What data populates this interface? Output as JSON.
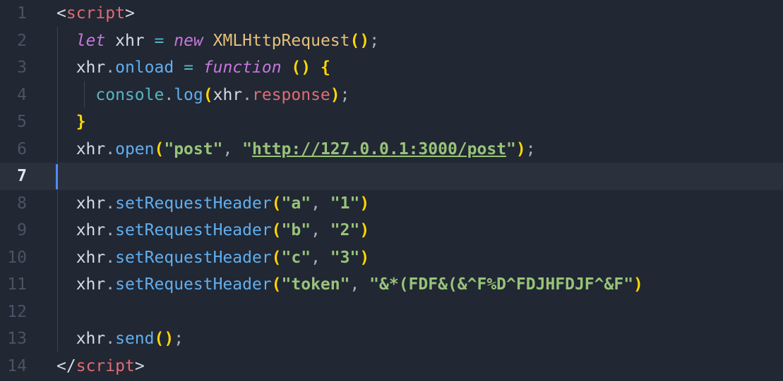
{
  "editor": {
    "lines": [
      {
        "num": "1",
        "tokens": [
          {
            "t": "<",
            "c": "angle"
          },
          {
            "t": "script",
            "c": "tag"
          },
          {
            "t": ">",
            "c": "angle"
          }
        ]
      },
      {
        "num": "2",
        "tokens": [
          {
            "t": "  "
          },
          {
            "t": "let",
            "c": "kw"
          },
          {
            "t": " xhr ",
            "c": "var"
          },
          {
            "t": "=",
            "c": "op"
          },
          {
            "t": " "
          },
          {
            "t": "new",
            "c": "kw"
          },
          {
            "t": " "
          },
          {
            "t": "XMLHttpRequest",
            "c": "cls"
          },
          {
            "t": "()",
            "c": "paren"
          },
          {
            "t": ";",
            "c": "punc"
          }
        ]
      },
      {
        "num": "3",
        "tokens": [
          {
            "t": "  "
          },
          {
            "t": "xhr",
            "c": "var"
          },
          {
            "t": ".",
            "c": "punc"
          },
          {
            "t": "onload",
            "c": "prop"
          },
          {
            "t": " "
          },
          {
            "t": "=",
            "c": "op"
          },
          {
            "t": " "
          },
          {
            "t": "function",
            "c": "fn"
          },
          {
            "t": " "
          },
          {
            "t": "()",
            "c": "paren"
          },
          {
            "t": " "
          },
          {
            "t": "{",
            "c": "brace"
          }
        ]
      },
      {
        "num": "4",
        "tokens": [
          {
            "t": "    "
          },
          {
            "t": "console",
            "c": "console"
          },
          {
            "t": ".",
            "c": "punc"
          },
          {
            "t": "log",
            "c": "meth"
          },
          {
            "t": "(",
            "c": "paren"
          },
          {
            "t": "xhr",
            "c": "var"
          },
          {
            "t": ".",
            "c": "punc"
          },
          {
            "t": "response",
            "c": "resp"
          },
          {
            "t": ")",
            "c": "paren"
          },
          {
            "t": ";",
            "c": "punc"
          }
        ]
      },
      {
        "num": "5",
        "tokens": [
          {
            "t": "  "
          },
          {
            "t": "}",
            "c": "brace"
          }
        ]
      },
      {
        "num": "6",
        "tokens": [
          {
            "t": "  "
          },
          {
            "t": "xhr",
            "c": "var"
          },
          {
            "t": ".",
            "c": "punc"
          },
          {
            "t": "open",
            "c": "meth"
          },
          {
            "t": "(",
            "c": "paren"
          },
          {
            "t": "\"post\"",
            "c": "str"
          },
          {
            "t": ", ",
            "c": "punc"
          },
          {
            "t": "\"",
            "c": "str"
          },
          {
            "t": "http://127.0.0.1:3000/post",
            "c": "url"
          },
          {
            "t": "\"",
            "c": "str"
          },
          {
            "t": ")",
            "c": "paren"
          },
          {
            "t": ";",
            "c": "punc"
          }
        ]
      },
      {
        "num": "7",
        "current": true,
        "tokens": []
      },
      {
        "num": "8",
        "tokens": [
          {
            "t": "  "
          },
          {
            "t": "xhr",
            "c": "var"
          },
          {
            "t": ".",
            "c": "punc"
          },
          {
            "t": "setRequestHeader",
            "c": "meth"
          },
          {
            "t": "(",
            "c": "paren"
          },
          {
            "t": "\"a\"",
            "c": "str"
          },
          {
            "t": ", ",
            "c": "punc"
          },
          {
            "t": "\"1\"",
            "c": "str"
          },
          {
            "t": ")",
            "c": "paren"
          }
        ]
      },
      {
        "num": "9",
        "tokens": [
          {
            "t": "  "
          },
          {
            "t": "xhr",
            "c": "var"
          },
          {
            "t": ".",
            "c": "punc"
          },
          {
            "t": "setRequestHeader",
            "c": "meth"
          },
          {
            "t": "(",
            "c": "paren"
          },
          {
            "t": "\"b\"",
            "c": "str"
          },
          {
            "t": ", ",
            "c": "punc"
          },
          {
            "t": "\"2\"",
            "c": "str"
          },
          {
            "t": ")",
            "c": "paren"
          }
        ]
      },
      {
        "num": "10",
        "tokens": [
          {
            "t": "  "
          },
          {
            "t": "xhr",
            "c": "var"
          },
          {
            "t": ".",
            "c": "punc"
          },
          {
            "t": "setRequestHeader",
            "c": "meth"
          },
          {
            "t": "(",
            "c": "paren"
          },
          {
            "t": "\"c\"",
            "c": "str"
          },
          {
            "t": ", ",
            "c": "punc"
          },
          {
            "t": "\"3\"",
            "c": "str"
          },
          {
            "t": ")",
            "c": "paren"
          }
        ]
      },
      {
        "num": "11",
        "tokens": [
          {
            "t": "  "
          },
          {
            "t": "xhr",
            "c": "var"
          },
          {
            "t": ".",
            "c": "punc"
          },
          {
            "t": "setRequestHeader",
            "c": "meth"
          },
          {
            "t": "(",
            "c": "paren"
          },
          {
            "t": "\"token\"",
            "c": "str"
          },
          {
            "t": ", ",
            "c": "punc"
          },
          {
            "t": "\"&*(FDF&(&^F%D^FDJHFDJF^&F\"",
            "c": "str"
          },
          {
            "t": ")",
            "c": "paren"
          }
        ]
      },
      {
        "num": "12",
        "tokens": []
      },
      {
        "num": "13",
        "tokens": [
          {
            "t": "  "
          },
          {
            "t": "xhr",
            "c": "var"
          },
          {
            "t": ".",
            "c": "punc"
          },
          {
            "t": "send",
            "c": "meth"
          },
          {
            "t": "()",
            "c": "paren"
          },
          {
            "t": ";",
            "c": "punc"
          }
        ]
      },
      {
        "num": "14",
        "tokens": [
          {
            "t": "<",
            "c": "angle"
          },
          {
            "t": "/",
            "c": "angle"
          },
          {
            "t": "script",
            "c": "tag"
          },
          {
            "t": ">",
            "c": "angle"
          }
        ]
      }
    ]
  }
}
